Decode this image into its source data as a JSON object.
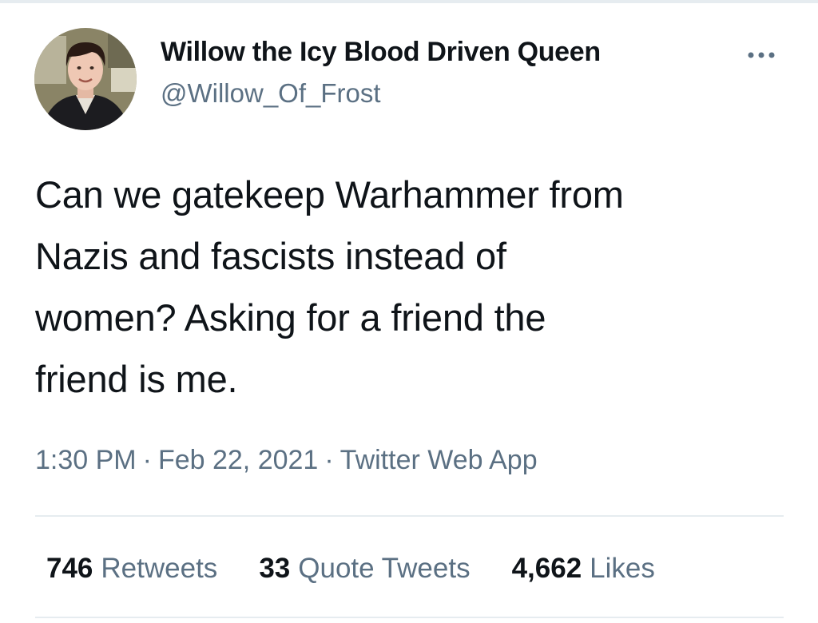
{
  "author": {
    "display_name": "Willow the Icy Blood Driven Queen",
    "handle": "@Willow_Of_Frost",
    "avatar_icon": "profile-photo"
  },
  "menu_icon": "more-horizontal-icon",
  "tweet": {
    "text_lines": [
      "Can we gatekeep Warhammer from",
      "Nazis and fascists instead of",
      "women? Asking for a friend the",
      "friend is me."
    ]
  },
  "meta": {
    "time": "1:30 PM",
    "separator": "·",
    "date": "Feb 22, 2021",
    "source": "Twitter Web App"
  },
  "stats": {
    "retweets_count": "746",
    "retweets_label": "Retweets",
    "quotes_count": "33",
    "quotes_label": "Quote Tweets",
    "likes_count": "4,662",
    "likes_label": "Likes"
  },
  "colors": {
    "text": "#0f1419",
    "secondary": "#5b7083",
    "divider": "#e6ecf0",
    "background": "#ffffff"
  }
}
